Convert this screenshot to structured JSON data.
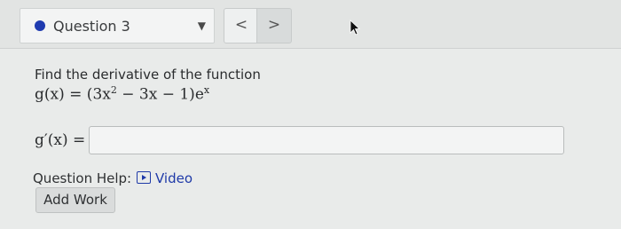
{
  "header": {
    "question_select_label": "Question 3",
    "prev_label": "<",
    "next_label": ">"
  },
  "problem": {
    "prompt": "Find the derivative of the function",
    "formula": {
      "lhs": "g(x) =",
      "open": "(",
      "t1": "3x",
      "t1_exp": "2",
      "t2": "− 3x − 1",
      "close": ")",
      "e": "e",
      "e_exp": "x"
    },
    "answer_label": "g′(x) =",
    "answer_value": ""
  },
  "help": {
    "label": "Question Help:",
    "video_label": "Video"
  },
  "actions": {
    "add_work_label": "Add Work"
  },
  "colors": {
    "accent": "#1f3bb0",
    "link": "#1f3aa8",
    "background": "#e9ebea"
  },
  "icons": {
    "status": "filled-circle-icon",
    "dropdown": "caret-down-icon",
    "video": "video-play-icon",
    "cursor": "pointer-arrow-icon"
  }
}
